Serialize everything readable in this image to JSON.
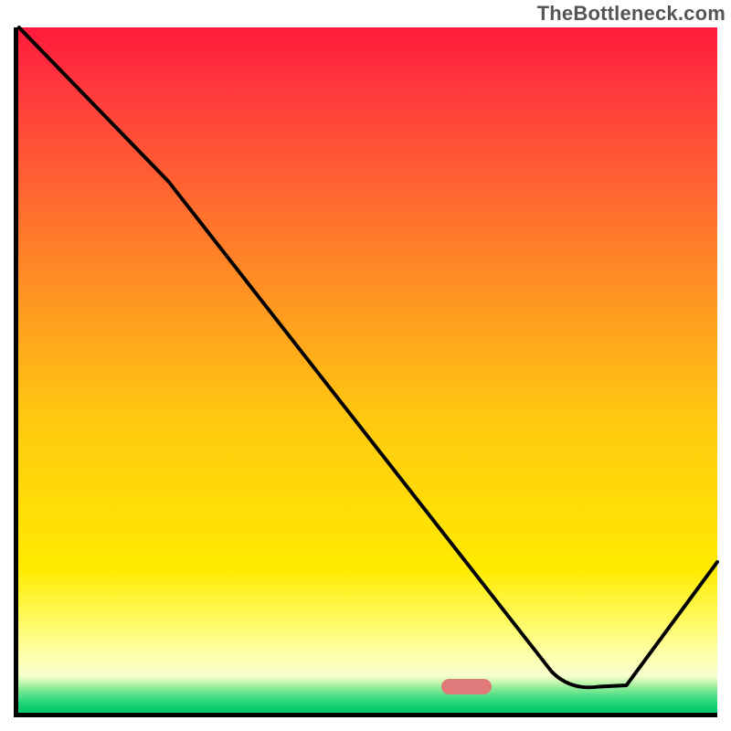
{
  "watermark": "TheBottleneck.com",
  "chart_data": {
    "type": "line",
    "title": "",
    "xlabel": "",
    "ylabel": "",
    "xlim": [
      0,
      100
    ],
    "ylim": [
      0,
      100
    ],
    "grid": false,
    "legend": null,
    "annotations": [
      {
        "name": "optimal-marker",
        "x_range": [
          60.5,
          67.7
        ],
        "y": 5
      }
    ],
    "background_gradient": {
      "stops": [
        {
          "pos": 0.0,
          "color": "#ff1a3c"
        },
        {
          "pos": 0.6,
          "color": "#ffc810"
        },
        {
          "pos": 0.79,
          "color": "#ffeb00"
        },
        {
          "pos": 0.92,
          "color": "#fdffa8"
        },
        {
          "pos": 0.945,
          "color": "#c8f8b0"
        },
        {
          "pos": 1.0,
          "color": "#05c968"
        }
      ]
    },
    "series": [
      {
        "name": "bottleneck-curve",
        "x": [
          0.1,
          21.5,
          76.3,
          79.0,
          83.0,
          87.0,
          100
        ],
        "values": [
          100,
          77.5,
          6.0,
          3.2,
          3.8,
          4.0,
          22.0
        ]
      }
    ]
  }
}
